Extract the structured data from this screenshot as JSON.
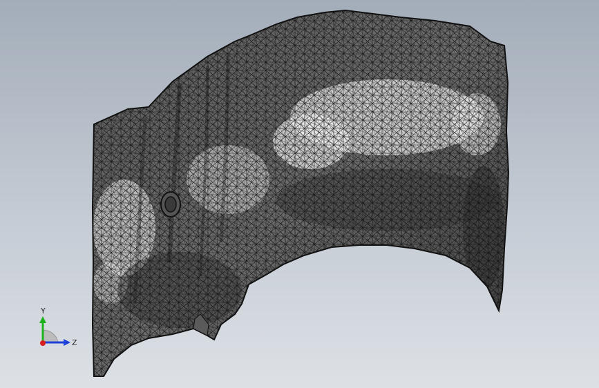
{
  "viewport": {
    "model": "mesh-body",
    "background_top": "#a3adb9",
    "background_bottom": "#dde1e6"
  },
  "triad": {
    "y_label": "Y",
    "z_label": "Z",
    "y_color": "#1fb21f",
    "z_color": "#1f3fd9",
    "x_color": "#d81f1f"
  }
}
